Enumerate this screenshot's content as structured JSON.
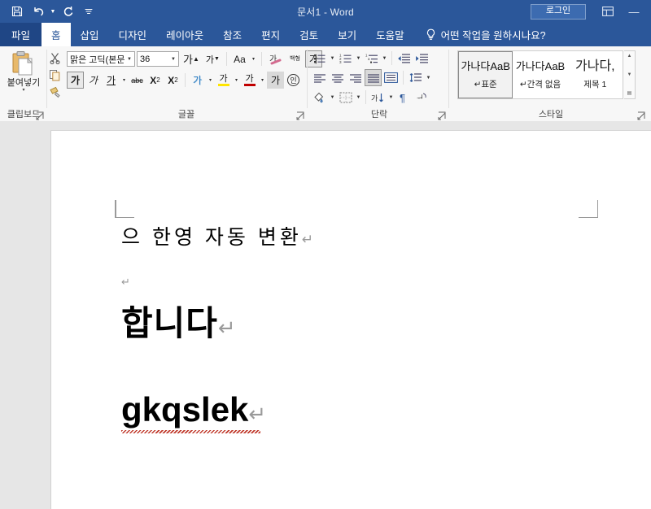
{
  "window": {
    "title": "문서1  -  Word",
    "signin_label": "로그인",
    "minimize_label": "—",
    "ribbon_display_options_icon": "ribbon-display-options-icon",
    "quick_access": [
      {
        "name": "save-icon",
        "label": "저장"
      },
      {
        "name": "undo-icon",
        "label": "실행 취소"
      },
      {
        "name": "redo-icon",
        "label": "다시 실행"
      },
      {
        "name": "customize-quick-access-icon",
        "label": "빠른 실행 도구 모음 사용자 지정"
      }
    ]
  },
  "tabs": [
    {
      "label": "파일",
      "active": false,
      "file": true
    },
    {
      "label": "홈",
      "active": true
    },
    {
      "label": "삽입",
      "active": false
    },
    {
      "label": "디자인",
      "active": false
    },
    {
      "label": "레이아웃",
      "active": false
    },
    {
      "label": "참조",
      "active": false
    },
    {
      "label": "편지",
      "active": false
    },
    {
      "label": "검토",
      "active": false
    },
    {
      "label": "보기",
      "active": false
    },
    {
      "label": "도움말",
      "active": false
    }
  ],
  "tell_me": {
    "icon": "lightbulb-icon",
    "placeholder": "어떤 작업을 원하시나요?"
  },
  "ribbon": {
    "clipboard": {
      "group_label": "클립보드",
      "paste_label": "붙여넣기",
      "paste_caret": "▾",
      "buttons": [
        {
          "name": "cut-icon",
          "glyph": "✂"
        },
        {
          "name": "copy-icon",
          "glyph": "⧉"
        },
        {
          "name": "format-painter-icon",
          "glyph": "🖌"
        }
      ]
    },
    "font": {
      "group_label": "글꼴",
      "font_name": "맑은 고딕(본문",
      "font_size": "36",
      "grow_font": "가",
      "shrink_font": "가",
      "change_case": "Aa",
      "clear_formatting": "clear-formatting-icon",
      "phonetic_guide": "백형",
      "char_border": "가",
      "bold": "가",
      "italic": "가",
      "underline": "가",
      "strikethrough": "abc",
      "subscript": "X",
      "subscript_index": "2",
      "superscript": "X",
      "superscript_index": "2",
      "text_effects": "가",
      "highlight": "가",
      "font_color": "가",
      "char_shading": "가",
      "enclose_char": "인",
      "caret": "▾"
    },
    "paragraph": {
      "group_label": "단락",
      "row1": [
        {
          "name": "bullets-icon"
        },
        {
          "name": "bullets-caret-icon",
          "caret": true
        },
        {
          "name": "numbering-icon"
        },
        {
          "name": "numbering-caret-icon",
          "caret": true
        },
        {
          "name": "multilevel-list-icon"
        },
        {
          "name": "multilevel-caret-icon",
          "caret": true
        },
        {
          "name": "decrease-indent-icon"
        },
        {
          "name": "increase-indent-icon"
        }
      ],
      "row2": [
        {
          "name": "align-left-icon"
        },
        {
          "name": "align-center-icon"
        },
        {
          "name": "align-right-icon"
        },
        {
          "name": "justify-icon",
          "active": true
        },
        {
          "name": "distribute-icon"
        },
        {
          "name": "line-spacing-icon"
        },
        {
          "name": "line-spacing-caret-icon",
          "caret": true
        }
      ],
      "row3": [
        {
          "name": "shading-icon"
        },
        {
          "name": "shading-caret-icon",
          "caret": true
        },
        {
          "name": "borders-icon"
        },
        {
          "name": "borders-caret-icon",
          "caret": true
        },
        {
          "name": "sort-icon"
        },
        {
          "name": "sort-caret-icon",
          "caret": true
        },
        {
          "name": "show-formatting-marks-icon"
        },
        {
          "name": "asian-layout-icon"
        }
      ]
    },
    "styles": {
      "group_label": "스타일",
      "items": [
        {
          "preview": "가나다AaB",
          "name": "↵표준",
          "selected": true
        },
        {
          "preview": "가나다AaB",
          "name": "↵간격 없음",
          "selected": false
        },
        {
          "preview": "가나다,",
          "name": "제목 1",
          "selected": false,
          "big": true
        }
      ],
      "scroll_up": "▲",
      "scroll_down": "▼",
      "scroll_more": "▤"
    }
  },
  "document": {
    "lines": [
      {
        "text": "으 한영 자동 변환",
        "mark": "↵",
        "style": "normal"
      },
      {
        "text": "",
        "mark": "↵",
        "style": "empty"
      },
      {
        "text": "합니다",
        "mark": "↵",
        "style": "heading"
      },
      {
        "text": "gkqslek",
        "mark": "↵",
        "style": "heading",
        "misspelled": true
      }
    ]
  },
  "colors": {
    "title_bar": "#2b579a",
    "tab_file": "#1f4685",
    "ribbon_bg": "#f7f7f7",
    "doc_bg": "#e6e6e6",
    "page": "#ffffff",
    "mark_gray": "#9a9a9a",
    "spell_error": "#c0392b",
    "accent_highlight": "#d6e3f4"
  }
}
